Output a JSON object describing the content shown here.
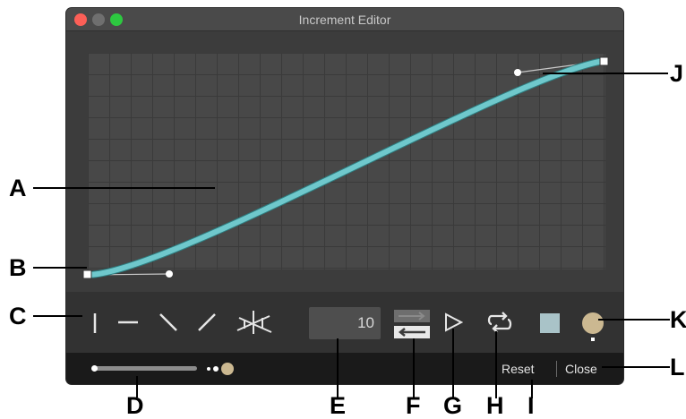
{
  "window": {
    "title": "Increment Editor"
  },
  "toolbar": {
    "presets": [
      "vertical-line-preset",
      "horizontal-line-preset",
      "ease-down-preset",
      "ease-up-preset",
      "random-scatter-preset"
    ],
    "count_value": "10",
    "swap_icon": "swap-direction-icon",
    "play_icon": "play-icon",
    "loop_icon": "loop-icon",
    "colors": {
      "curve": "#6fc8cc",
      "square_swatch": "#a9c3c8",
      "circle_swatch": "#cbb891"
    }
  },
  "bottom": {
    "reset_label": "Reset",
    "close_label": "Close"
  },
  "callouts": {
    "A": "A",
    "B": "B",
    "C": "C",
    "D": "D",
    "E": "E",
    "F": "F",
    "G": "G",
    "H": "H",
    "I": "I",
    "J": "J",
    "K": "K",
    "L": "L"
  }
}
